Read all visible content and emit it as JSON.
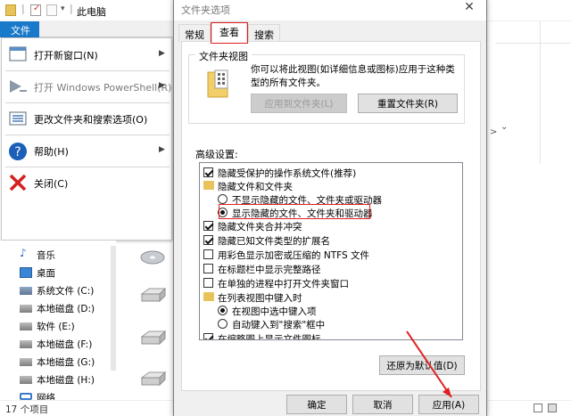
{
  "explorer": {
    "title": "此电脑",
    "file_tab": "文件",
    "status": "17 个项目",
    "file_menu": {
      "items": [
        {
          "label": "打开新窗口(N)",
          "has_arrow": true,
          "icon": "window-icon",
          "disabled": false
        },
        {
          "label": "打开 Windows PowerShell(R)",
          "has_arrow": true,
          "icon": "powershell-icon",
          "disabled": true
        },
        {
          "label": "更改文件夹和搜索选项(O)",
          "has_arrow": false,
          "icon": "options-icon",
          "disabled": false
        },
        {
          "label": "帮助(H)",
          "has_arrow": true,
          "icon": "help-icon",
          "disabled": false
        },
        {
          "label": "关闭(C)",
          "has_arrow": false,
          "icon": "close-x-icon",
          "disabled": false
        }
      ]
    },
    "nav_items": [
      {
        "label": "音乐",
        "icon": "music-icon"
      },
      {
        "label": "桌面",
        "icon": "desktop-icon"
      },
      {
        "label": "系统文件 (C:)",
        "icon": "drive-icon"
      },
      {
        "label": "本地磁盘 (D:)",
        "icon": "drive-icon"
      },
      {
        "label": "软件 (E:)",
        "icon": "drive-icon"
      },
      {
        "label": "本地磁盘 (F:)",
        "icon": "drive-icon"
      },
      {
        "label": "本地磁盘 (G:)",
        "icon": "drive-icon"
      },
      {
        "label": "本地磁盘 (H:)",
        "icon": "drive-icon"
      },
      {
        "label": "网络",
        "icon": "network-icon"
      }
    ],
    "right_chevron": "⌄",
    "right_arrow": ">"
  },
  "dialog": {
    "title": "文件夹选项",
    "close": "✕",
    "tabs": [
      "常规",
      "查看",
      "搜索"
    ],
    "active_tab": "查看",
    "folder_view": {
      "legend": "文件夹视图",
      "description": "你可以将此视图(如详细信息或图标)应用于这种类型的所有文件夹。",
      "apply_button": "应用到文件夹(L)",
      "reset_button": "重置文件夹(R)"
    },
    "advanced_label": "高级设置:",
    "advanced_items": [
      {
        "type": "checkbox",
        "checked": true,
        "indent": 0,
        "label": "隐藏受保护的操作系统文件(推荐)"
      },
      {
        "type": "folder",
        "indent": 0,
        "label": "隐藏文件和文件夹"
      },
      {
        "type": "radio",
        "checked": false,
        "indent": 1,
        "label": "不显示隐藏的文件、文件夹或驱动器"
      },
      {
        "type": "radio",
        "checked": true,
        "indent": 1,
        "label": "显示隐藏的文件、文件夹和驱动器"
      },
      {
        "type": "checkbox",
        "checked": true,
        "indent": 0,
        "label": "隐藏文件夹合并冲突"
      },
      {
        "type": "checkbox",
        "checked": true,
        "indent": 0,
        "label": "隐藏已知文件类型的扩展名"
      },
      {
        "type": "checkbox",
        "checked": false,
        "indent": 0,
        "label": "用彩色显示加密或压缩的 NTFS 文件"
      },
      {
        "type": "checkbox",
        "checked": false,
        "indent": 0,
        "label": "在标题栏中显示完整路径"
      },
      {
        "type": "checkbox",
        "checked": false,
        "indent": 0,
        "label": "在单独的进程中打开文件夹窗口"
      },
      {
        "type": "folder",
        "indent": 0,
        "label": "在列表视图中键入时"
      },
      {
        "type": "radio",
        "checked": true,
        "indent": 1,
        "label": "在视图中选中键入项"
      },
      {
        "type": "radio",
        "checked": false,
        "indent": 1,
        "label": "自动键入到\"搜索\"框中"
      },
      {
        "type": "checkbox",
        "checked": true,
        "indent": 0,
        "label": "在缩略图上显示文件图标"
      }
    ],
    "restore_button": "还原为默认值(D)",
    "ok_button": "确定",
    "cancel_button": "取消",
    "apply_button": "应用(A)"
  }
}
